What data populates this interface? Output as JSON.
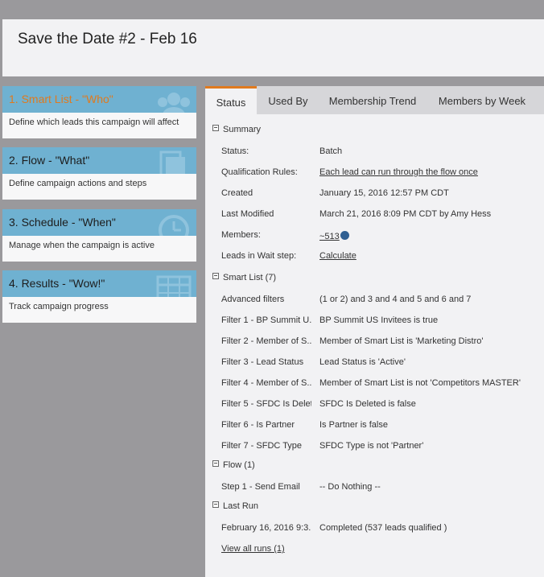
{
  "header": {
    "title": "Save the Date #2 - Feb 16"
  },
  "steps": [
    {
      "label": "1. Smart List - \"Who\"",
      "desc": "Define which leads this campaign will affect",
      "icon": "people-icon"
    },
    {
      "label": "2. Flow - \"What\"",
      "desc": "Define campaign actions and steps",
      "icon": "pages-icon"
    },
    {
      "label": "3. Schedule - \"When\"",
      "desc": "Manage when the campaign is active",
      "icon": "clock-icon"
    },
    {
      "label": "4. Results - \"Wow!\"",
      "desc": "Track campaign progress",
      "icon": "calendar-grid-icon"
    }
  ],
  "tabs": [
    "Status",
    "Used By",
    "Membership Trend",
    "Members by Week"
  ],
  "summary": {
    "heading": "Summary",
    "rows": [
      {
        "k": "Status:",
        "v": "Batch"
      },
      {
        "k": "Qualification Rules:",
        "v": "Each lead can run through the flow once"
      },
      {
        "k": "Created",
        "v": "January 15, 2016 12:57 PM CDT"
      },
      {
        "k": "Last Modified",
        "v": "March 21, 2016 8:09 PM CDT by Amy Hess"
      },
      {
        "k": "Members:",
        "v": "~513"
      },
      {
        "k": "Leads in Wait step:",
        "v": "Calculate"
      }
    ]
  },
  "smartlist": {
    "heading": "Smart List (7)",
    "rows": [
      {
        "k": "Advanced filters",
        "v": "(1 or 2) and 3 and 4 and 5 and 6 and 7"
      },
      {
        "k": "Filter 1 - BP Summit U...",
        "v": "BP Summit US Invitees is true"
      },
      {
        "k": "Filter 2 - Member of S...",
        "v": "Member of Smart List is 'Marketing Distro'"
      },
      {
        "k": "Filter 3 - Lead Status",
        "v": "Lead Status is 'Active'"
      },
      {
        "k": "Filter 4 - Member of S...",
        "v": "Member of Smart List is not 'Competitors MASTER'"
      },
      {
        "k": "Filter 5 - SFDC Is Delet...",
        "v": "SFDC Is Deleted is false"
      },
      {
        "k": "Filter 6 - Is Partner",
        "v": "Is Partner is false"
      },
      {
        "k": "Filter 7 - SFDC Type",
        "v": "SFDC Type is not 'Partner'"
      }
    ]
  },
  "flow": {
    "heading": "Flow (1)",
    "rows": [
      {
        "k": "Step 1 - Send Email",
        "v": "-- Do Nothing --"
      }
    ]
  },
  "lastrun": {
    "heading": "Last Run",
    "rows": [
      {
        "k": "February 16, 2016 9:3...",
        "v": "Completed  (537 leads qualified )"
      }
    ],
    "view_all": "View all runs (1)"
  },
  "colors": {
    "accent": "#e07a1e",
    "band": "#6fb1d1",
    "background": "#9a999c"
  }
}
